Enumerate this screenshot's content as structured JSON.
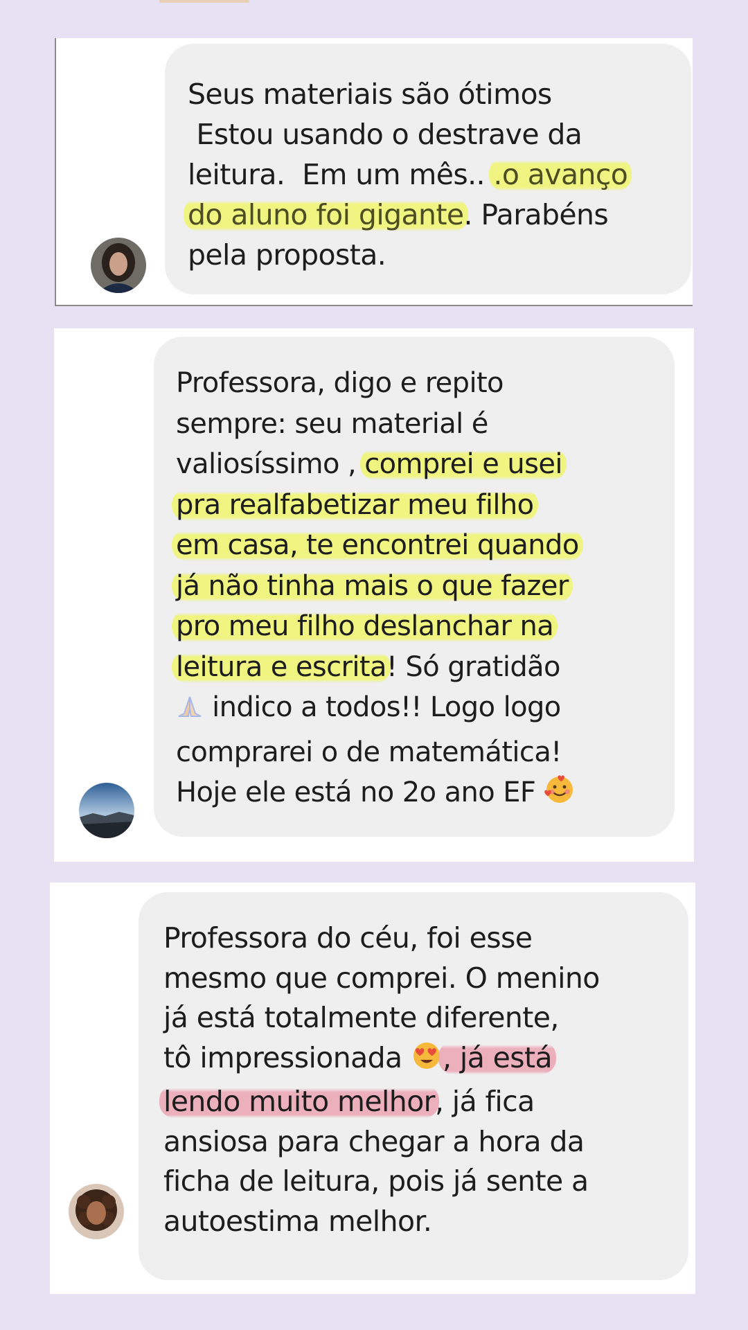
{
  "colors": {
    "background": "#e6e2f3",
    "card": "#ffffff",
    "bubble": "#efefef",
    "highlight_yellow": "#f0f56e",
    "highlight_pink": "#eca5b4"
  },
  "comments": [
    {
      "avatar_icon": "woman-dark-hair-avatar",
      "lines": [
        {
          "parts": [
            "Seus materiais são ótimos"
          ]
        },
        {
          "parts": [
            " Estou usando o destrave da"
          ]
        },
        {
          "parts": [
            "leitura.  Em um mês.. ",
            ".o avanço"
          ]
        },
        {
          "parts": [
            "do aluno foi gigante",
            ". Parabéns"
          ]
        },
        {
          "parts": [
            "pela proposta."
          ]
        }
      ]
    },
    {
      "avatar_icon": "landscape-avatar",
      "lines": [
        {
          "parts": [
            "Professora, digo e repito"
          ]
        },
        {
          "parts": [
            "sempre: seu material é"
          ]
        },
        {
          "parts": [
            "valiosíssimo , ",
            "comprei e usei"
          ]
        },
        {
          "parts": [
            "pra realfabetizar meu filho"
          ]
        },
        {
          "parts": [
            "em casa, te encontrei quando"
          ]
        },
        {
          "parts": [
            "já não tinha mais o que fazer"
          ]
        },
        {
          "parts": [
            "pro meu filho deslanchar na"
          ]
        },
        {
          "parts": [
            "leitura e escrita",
            "! Só gratidão"
          ]
        },
        {
          "parts": [
            " indico a todos!! Logo logo"
          ]
        },
        {
          "parts": [
            "comprarei o de matemática!"
          ]
        },
        {
          "parts": [
            "Hoje ele está no 2o ano EF "
          ]
        }
      ],
      "emoji_pray": "praying-hands-icon",
      "emoji_love": "smiling-face-with-hearts-icon"
    },
    {
      "avatar_icon": "woman-curly-hair-avatar",
      "lines": [
        {
          "parts": [
            "Professora do céu, foi esse"
          ]
        },
        {
          "parts": [
            "mesmo que comprei. O menino"
          ]
        },
        {
          "parts": [
            "já está totalmente diferente,"
          ]
        },
        {
          "parts": [
            "tô impressionada ",
            ", já está"
          ]
        },
        {
          "parts": [
            "lendo muito melhor",
            ", já fica"
          ]
        },
        {
          "parts": [
            "ansiosa para chegar a hora da"
          ]
        },
        {
          "parts": [
            "ficha de leitura, pois já sente a"
          ]
        },
        {
          "parts": [
            "autoestima melhor."
          ]
        }
      ],
      "emoji_heart_eyes": "heart-eyes-icon"
    }
  ]
}
